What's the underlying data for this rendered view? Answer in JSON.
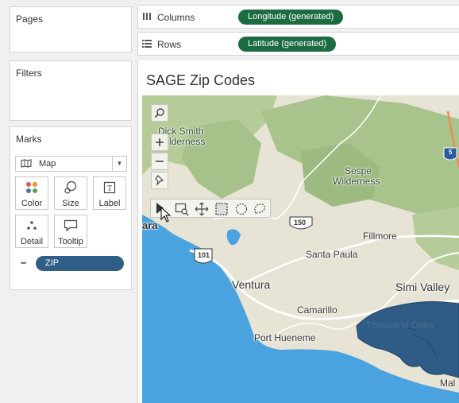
{
  "cards": {
    "pages": "Pages",
    "filters": "Filters",
    "marks": "Marks"
  },
  "marks": {
    "type_label": "Map",
    "buttons": {
      "color": "Color",
      "size": "Size",
      "label": "Label",
      "detail": "Detail",
      "tooltip": "Tooltip"
    },
    "field_pill": "ZIP"
  },
  "shelves": {
    "columns_label": "Columns",
    "columns_pill": "Longitude (generated)",
    "rows_label": "Rows",
    "rows_pill": "Latitude (generated)"
  },
  "sheet": {
    "title": "SAGE Zip Codes"
  },
  "map": {
    "labels": {
      "dick_smith_1": "Dick Smith",
      "dick_smith_2": "Wilderness",
      "sespe_1": "Sespe",
      "sespe_2": "Wilderness",
      "barbara_fragment": "ara",
      "fillmore": "Fillmore",
      "santa_paula": "Santa Paula",
      "ventura": "Ventura",
      "simi_valley": "Simi Valley",
      "camarillo": "Camarillo",
      "port_hueneme": "Port Hueneme",
      "thousand_oaks": "Thousand Oaks",
      "malibu_fragment": "Mal"
    },
    "shields": {
      "hwy_150": "150",
      "hwy_101": "101",
      "hwy_5": "5"
    },
    "colors": {
      "zip_fill": "#2e5c86",
      "ocean": "#4aa3df",
      "green_land": "#a9c38c",
      "land": "#e7e3d5"
    }
  },
  "icons": {
    "columns": "columns-icon",
    "rows": "rows-icon",
    "map_mark": "map-mark-icon",
    "search": "search-icon",
    "zoom_in": "zoom-in-icon",
    "zoom_out": "zoom-out-icon",
    "pin": "pin-icon",
    "play": "arrow-select-icon",
    "zoom_area": "zoom-area-icon",
    "pan": "pan-icon",
    "rect_select": "rectangle-select-icon",
    "radial_select": "radial-select-icon",
    "lasso_select": "lasso-select-icon"
  }
}
